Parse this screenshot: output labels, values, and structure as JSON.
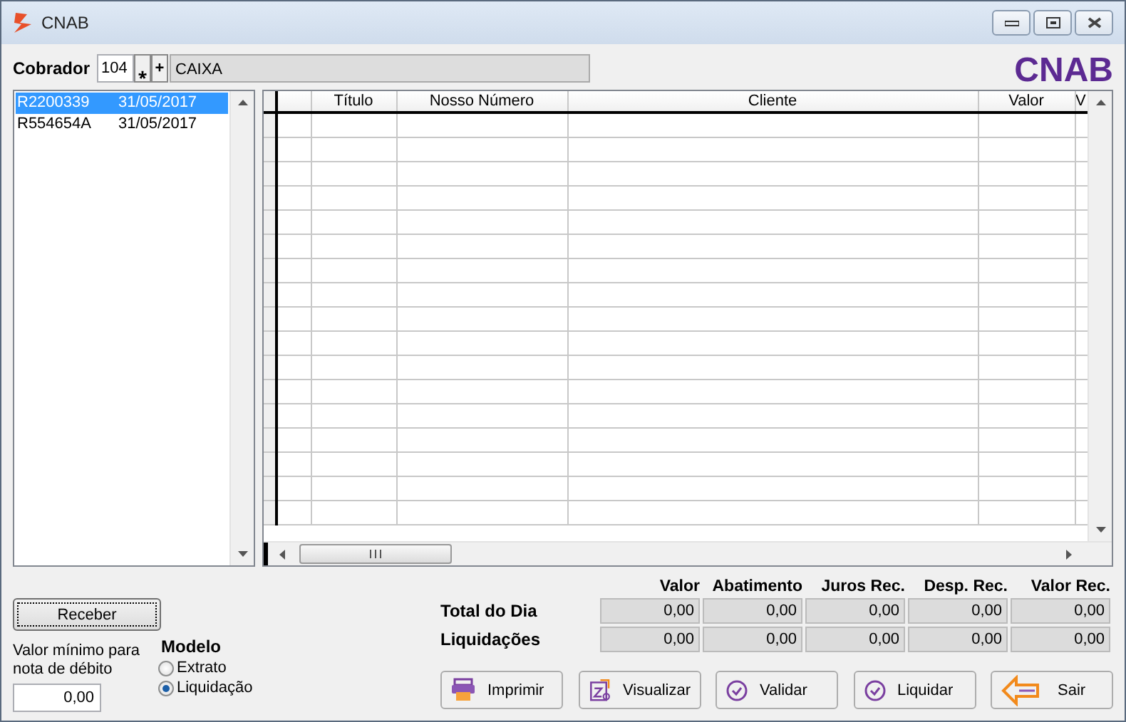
{
  "window": {
    "title": "CNAB"
  },
  "cobrador": {
    "label": "Cobrador",
    "code": "104",
    "buttons": [
      "⁎",
      "+"
    ],
    "name": "CAIXA"
  },
  "brand": "CNAB",
  "remessas": [
    {
      "code": "R2200339",
      "date": "31/05/2017",
      "selected": true
    },
    {
      "code": "R554654A",
      "date": "31/05/2017",
      "selected": false
    }
  ],
  "grid": {
    "columns": [
      "Título",
      "Nosso Número",
      "Cliente",
      "Valor",
      "V"
    ]
  },
  "receber_button": "Receber",
  "valor_minimo": {
    "label": "Valor mínimo para nota de débito",
    "value": "0,00"
  },
  "modelo": {
    "label": "Modelo",
    "options": [
      {
        "label": "Extrato",
        "selected": false
      },
      {
        "label": "Liquidação",
        "selected": true
      }
    ]
  },
  "totals": {
    "columns": [
      "Valor",
      "Abatimento",
      "Juros Rec.",
      "Desp. Rec.",
      "Valor Rec."
    ],
    "rows": [
      {
        "label": "Total do Dia",
        "values": [
          "0,00",
          "0,00",
          "0,00",
          "0,00",
          "0,00"
        ]
      },
      {
        "label": "Liquidações",
        "values": [
          "0,00",
          "0,00",
          "0,00",
          "0,00",
          "0,00"
        ]
      }
    ]
  },
  "buttons": [
    {
      "label": "Imprimir",
      "kind": "print"
    },
    {
      "label": "Visualizar",
      "kind": "preview"
    },
    {
      "label": "Validar",
      "kind": "check"
    },
    {
      "label": "Liquidar",
      "kind": "check"
    },
    {
      "label": "Sair",
      "kind": "exit"
    }
  ]
}
